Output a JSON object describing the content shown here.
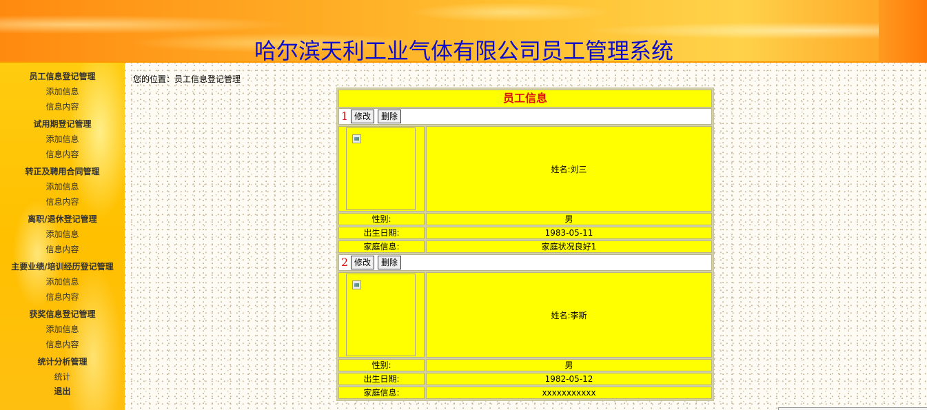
{
  "banner": {
    "title": "哈尔滨天利工业气体有限公司员工管理系统"
  },
  "sidebar": {
    "groups": [
      {
        "title": "员工信息登记管理",
        "items": [
          "添加信息",
          "信息内容"
        ]
      },
      {
        "title": "试用期登记管理",
        "items": [
          "添加信息",
          "信息内容"
        ]
      },
      {
        "title": "转正及聘用合同管理",
        "items": [
          "添加信息",
          "信息内容"
        ]
      },
      {
        "title": "离职/退休登记管理",
        "items": [
          "添加信息",
          "信息内容"
        ]
      },
      {
        "title": "主要业绩/培训经历登记管理",
        "items": [
          "添加信息",
          "信息内容"
        ]
      },
      {
        "title": "获奖信息登记管理",
        "items": [
          "添加信息",
          "信息内容"
        ]
      },
      {
        "title": "统计分析管理",
        "items": [
          "统计"
        ]
      }
    ],
    "logout": "退出"
  },
  "breadcrumb": {
    "text": "您的位置：员工信息登记管理"
  },
  "panel": {
    "title": "员工信息",
    "edit_label": "修改",
    "delete_label": "删除",
    "labels": {
      "gender": "性别:",
      "birth": "出生日期:",
      "family": "家庭信息:"
    },
    "records": [
      {
        "num": "1",
        "name": "姓名:刘三",
        "gender": "男",
        "birth": "1983-05-11",
        "family": "家庭状况良好1"
      },
      {
        "num": "2",
        "name": "姓名:李斯",
        "gender": "男",
        "birth": "1982-05-12",
        "family": "xxxxxxxxxxx"
      }
    ]
  },
  "colors": {
    "accent_title": "#0d0dcc",
    "panel_bg": "#ffff00",
    "highlight_red": "#dd1111"
  }
}
